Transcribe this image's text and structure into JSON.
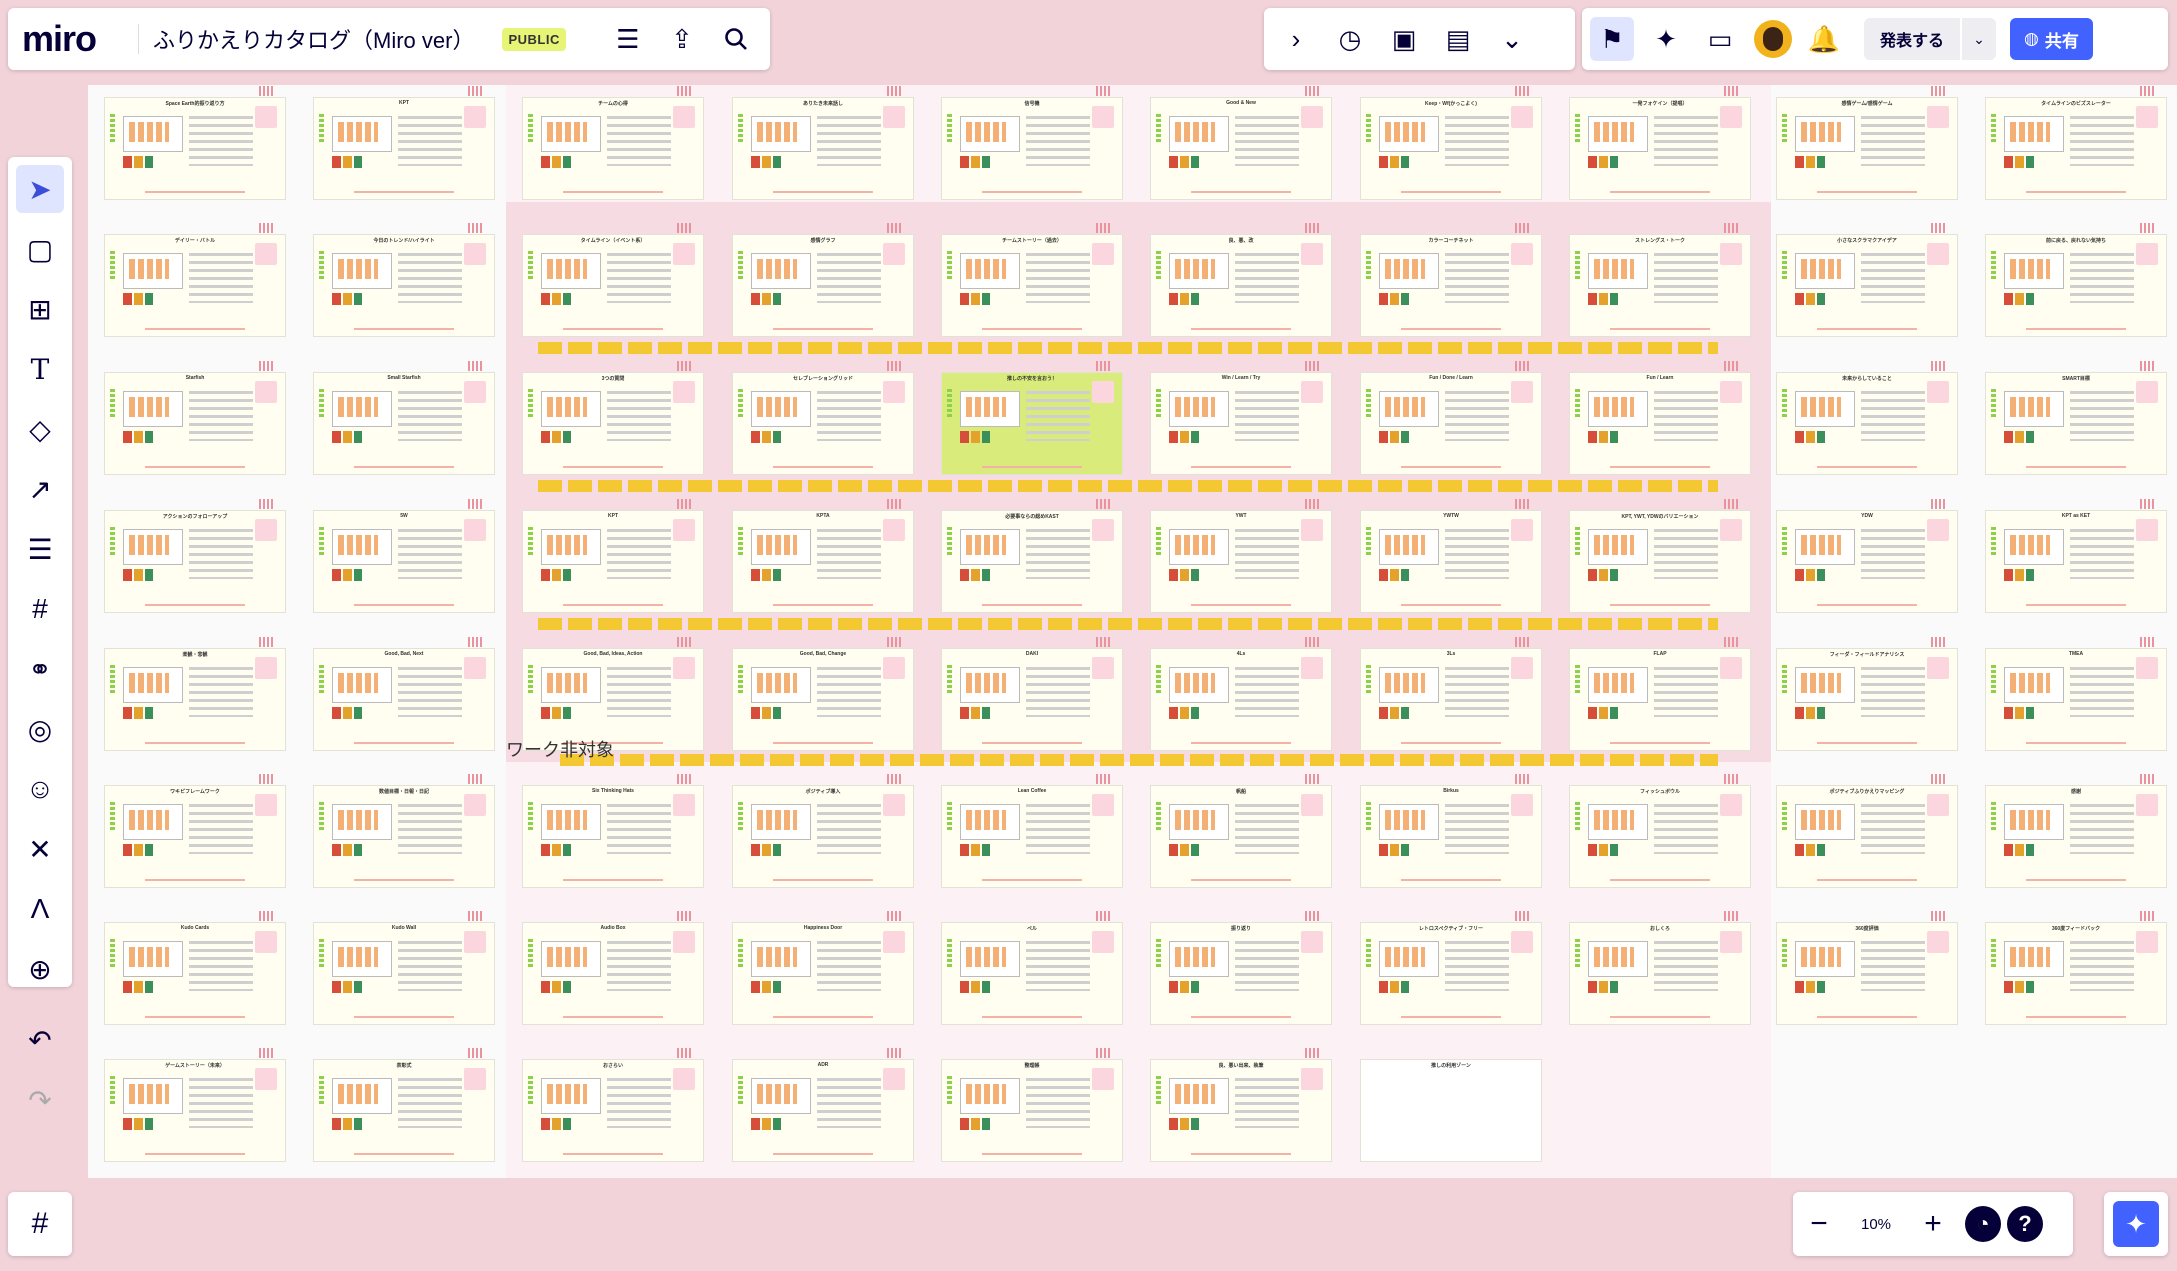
{
  "app": {
    "logo": "miro",
    "board_title": "ふりかえりカタログ（Miro ver）",
    "visibility_badge": "PUBLIC"
  },
  "toolbar": {
    "menu_icon": "menu-icon",
    "export_icon": "export-icon",
    "search_icon": "search-icon",
    "right_icons": [
      "chevron-right-icon",
      "timer-icon",
      "voting-icon",
      "notes-icon",
      "chevron-double-down-icon"
    ],
    "present_label": "発表する",
    "share_label": "共有"
  },
  "sidebar": {
    "tools": [
      "select-icon",
      "sticky-note-icon",
      "table-icon",
      "text-icon",
      "shapes-icon",
      "line-icon",
      "comment-icon",
      "frame-icon",
      "mindmap-icon",
      "collab-icon",
      "emoji-icon",
      "more-apps-icon",
      "pen-icon",
      "add-icon"
    ]
  },
  "zoom": {
    "level": "10%",
    "minus": "−",
    "plus": "+",
    "help": "?"
  },
  "board": {
    "area_label": "ワーク非対象",
    "columns": [
      {
        "name": "left1",
        "cards": [
          "Space Earth的振り返り方",
          "KPT",
          "デイリー・バトル",
          "今日のトレンド/ハイライト",
          "Starfish",
          "Small Starfish",
          "アクションのフォローアップ",
          "5W",
          "楽観・悲観",
          "Good, Bad, Next",
          "ワキピフレームワーク",
          "数値目標・日報・日記",
          "Kudo Cards",
          "Kudo Wall",
          "ゲームストーリー（未来）",
          "表彰式"
        ]
      },
      {
        "name": "mid",
        "cards": [
          "チームの心得",
          "ありたき未来話し",
          "信号機",
          "Good & New",
          "Keep・Wf(かっこよく)",
          "一発フォケイン（提唱）",
          "タイムライン（イベント系）",
          "感情グラフ",
          "チームストーリー（過去）",
          "良、悪、改",
          "カラーコーチネット",
          "ストレングス・トーク",
          "3つの質問",
          "セレブレーショングリッド",
          "推しの不安を言おう！",
          "Win / Learn / Try",
          "Fun / Done / Learn",
          "Fun / Learn",
          "KPT",
          "KPTA",
          "必要事ならの総めKAST",
          "YWT",
          "YWTW",
          "KPT, YWT, YDWのバリエーション",
          "Good, Bad, Ideas, Action",
          "Good, Bad, Change",
          "DAKI",
          "4Ls",
          "3Ls",
          "FLAP",
          "Six Thinking Hats",
          "ポジティブ導入",
          "Lean Coffee",
          "帆船",
          "Birkus",
          "フィッシュボウル",
          "Audio Box",
          "Happiness Door",
          "ペル",
          "振り返り",
          "レトロスペクティブ・フリー",
          "おしくろ",
          "おさらい",
          "ADR",
          "整理帳",
          "良、悪い出来、執筆",
          "推しの利用ゾーン"
        ]
      },
      {
        "name": "right",
        "cards": [
          "感情ゲーム/感情ゲーム",
          "タイムラインのビズスレーター",
          "小さなスクラマクアイデア",
          "前に戻る、戻れない気持ち",
          "未来からしていること",
          "SMART目標",
          "YDW",
          "KPT as KET",
          "フィーダ・フィールドアナリシス",
          "TMEA",
          "ポジティブふりかえりマッピング",
          "感謝",
          "360度評価",
          "360度フィードバック"
        ]
      }
    ]
  }
}
